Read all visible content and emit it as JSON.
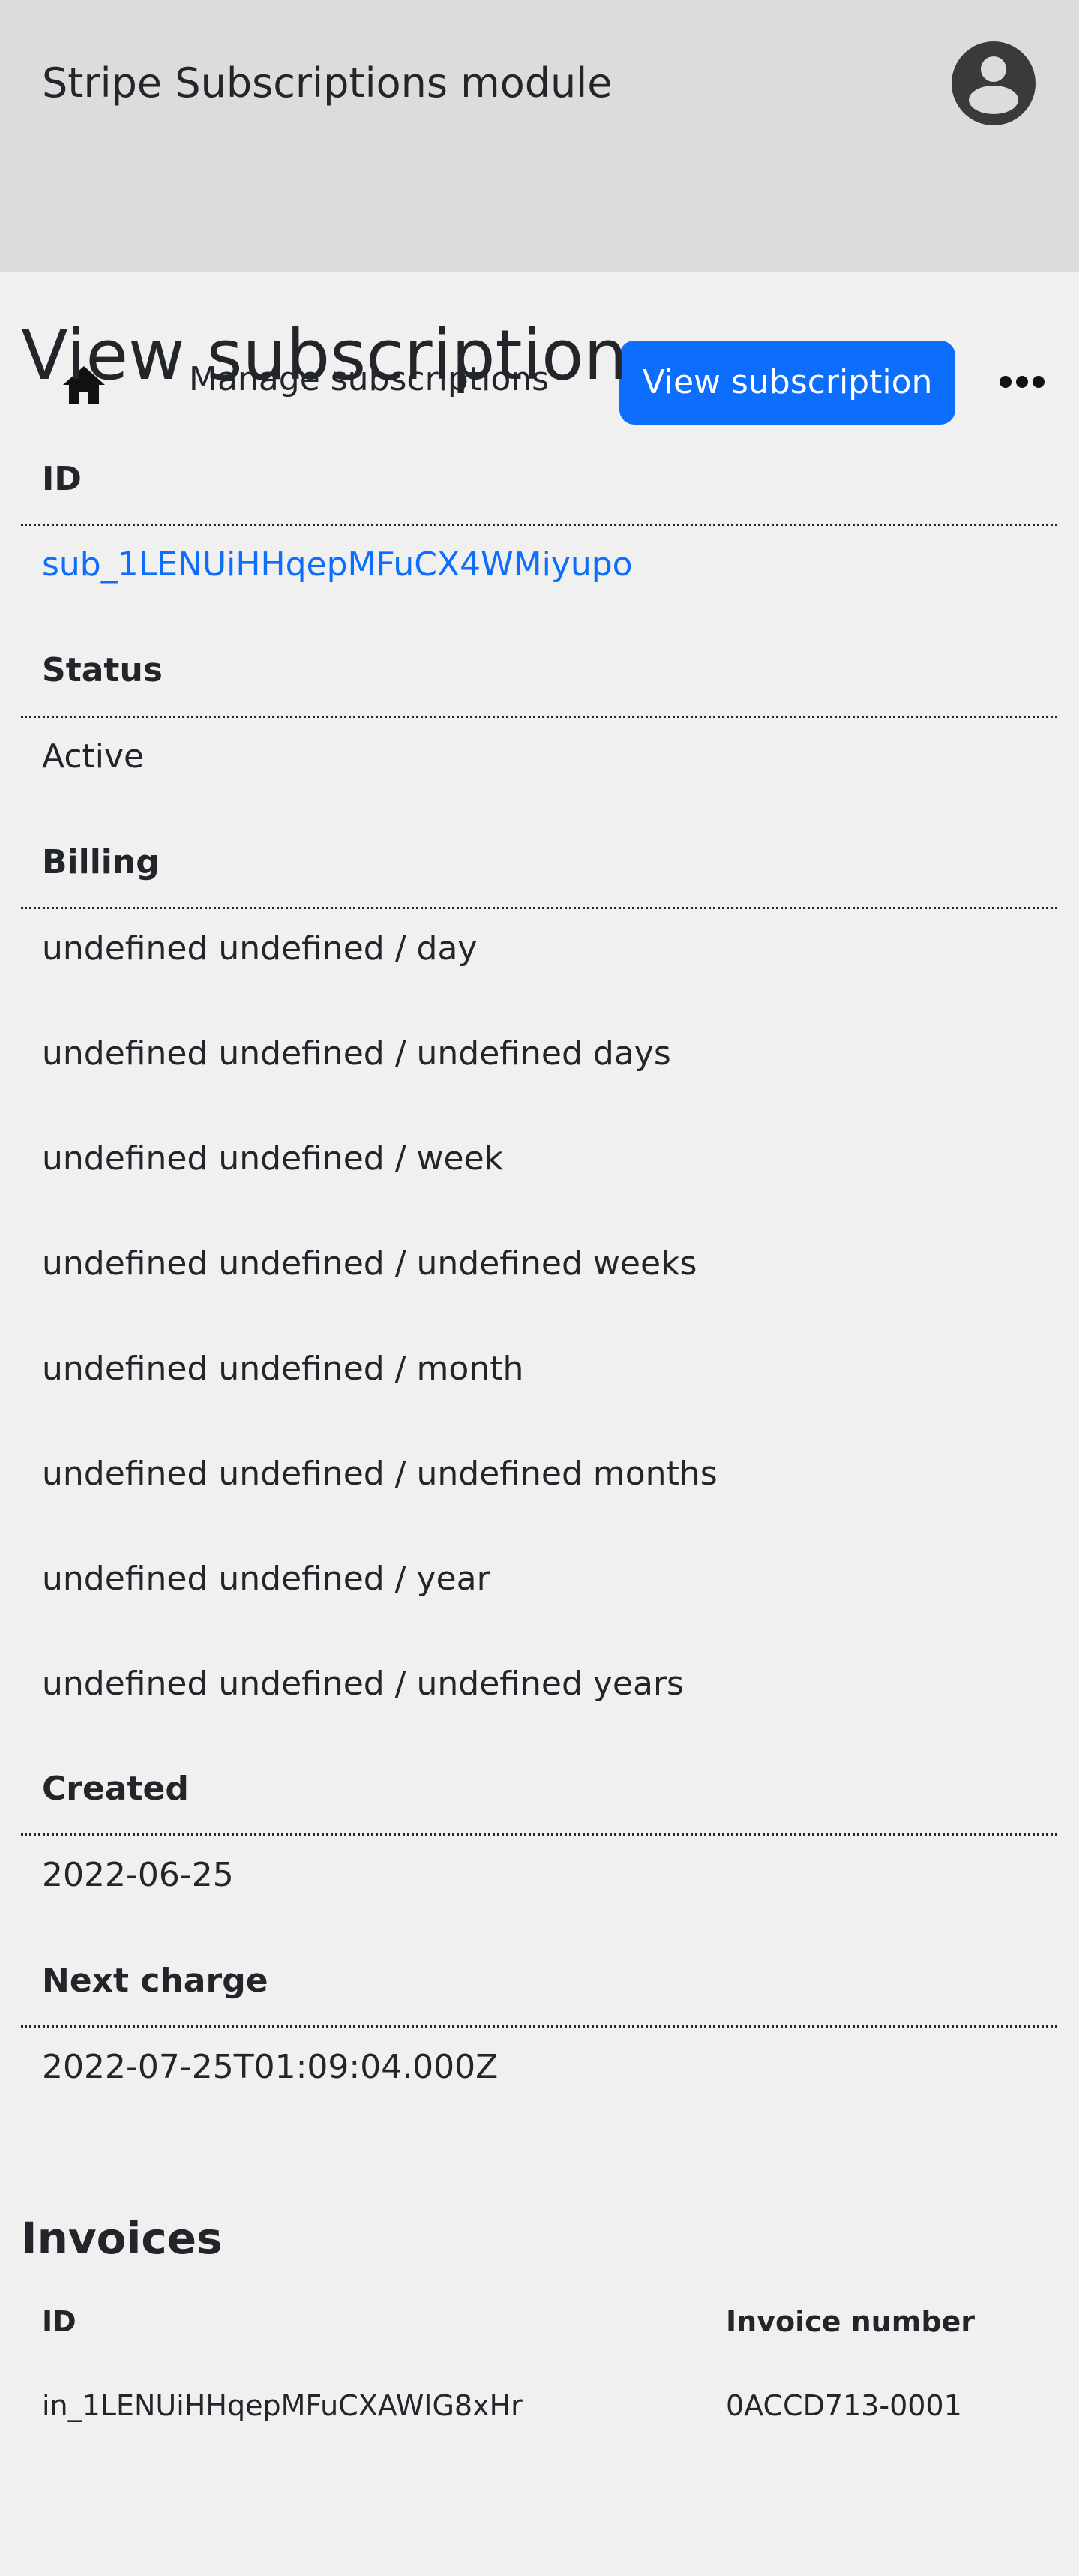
{
  "header": {
    "app_title": "Stripe Subscriptions module",
    "avatar_icon": "user-circle-icon"
  },
  "nav": {
    "home_icon": "home-icon",
    "manage_label": "Manage subscriptions",
    "view_label": "View subscription",
    "more_icon": "ellipsis-icon",
    "active_color": "#0d6efd"
  },
  "main": {
    "title": "View subscription",
    "fields": {
      "id_label": "ID",
      "id_value": "sub_1LENUiHHqepMFuCX4WMiyupo",
      "status_label": "Status",
      "status_value": "Active",
      "billing_label": "Billing",
      "billing_values": [
        "undefined undefined / day",
        "undefined undefined / undefined days",
        "undefined undefined / week",
        "undefined undefined / undefined weeks",
        "undefined undefined / month",
        "undefined undefined / undefined months",
        "undefined undefined / year",
        "undefined undefined / undefined years"
      ],
      "created_label": "Created",
      "created_value": "2022-06-25",
      "next_charge_label": "Next charge",
      "next_charge_value": "2022-07-25T01:09:04.000Z"
    },
    "invoices": {
      "title": "Invoices",
      "columns": [
        "ID",
        "Invoice number"
      ],
      "rows": [
        {
          "id": "in_1LENUiHHqepMFuCXAWIG8xHr",
          "number": "0ACCD713-0001"
        }
      ]
    }
  },
  "colors": {
    "header_bg": "#dcdcdc",
    "page_bg": "#f0f0f0",
    "link": "#0d6efd",
    "text": "#222529"
  }
}
